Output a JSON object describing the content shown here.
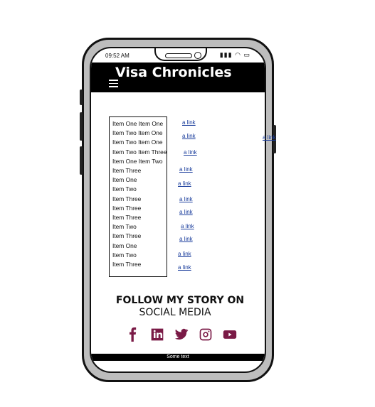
{
  "status": {
    "time": "09:52 AM"
  },
  "header": {
    "brand": "Visa Chronicles"
  },
  "menu": {
    "items": [
      "Item One Item One",
      "Item Two Item One",
      "Item Two Item One",
      "Item Two Item Three",
      "Item One Item Two",
      "Item Three",
      "Item One",
      "Item Two",
      "Item Three",
      "Item Three",
      "Item Three",
      "Item Two",
      "Item Three",
      "Item One",
      "Item Two",
      "Item Three"
    ]
  },
  "links": {
    "label": "a link",
    "count": 13
  },
  "stray_link": {
    "label": "a link"
  },
  "follow": {
    "line1": "FOLLOW MY STORY ON",
    "line2": "SOCIAL MEDIA"
  },
  "social": {
    "color": "#7a1a46",
    "icons": [
      "facebook-icon",
      "linkedin-icon",
      "twitter-icon",
      "instagram-icon",
      "youtube-icon"
    ]
  },
  "footer": {
    "text": "Some text"
  }
}
